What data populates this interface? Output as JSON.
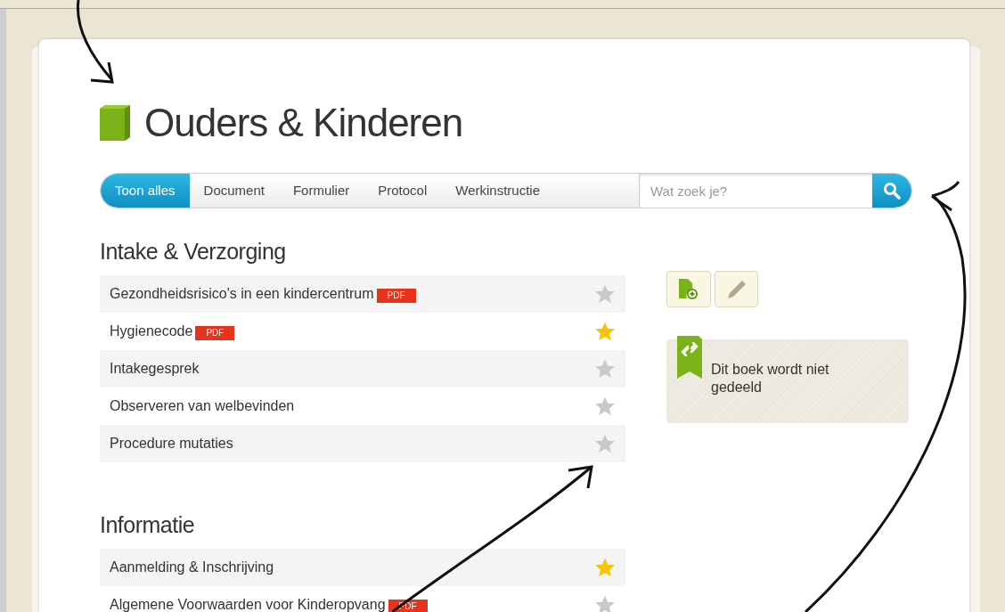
{
  "title": "Ouders & Kinderen",
  "filters": [
    {
      "label": "Toon alles",
      "selected": true
    },
    {
      "label": "Document",
      "selected": false
    },
    {
      "label": "Formulier",
      "selected": false
    },
    {
      "label": "Protocol",
      "selected": false
    },
    {
      "label": "Werkinstructie",
      "selected": false
    }
  ],
  "search": {
    "placeholder": "Wat zoek je?"
  },
  "sections": [
    {
      "heading": "Intake & Verzorging",
      "items": [
        {
          "name": "Gezondheidsrisico's in een kindercentrum",
          "badge": "PDF",
          "starred": false
        },
        {
          "name": "Hygienecode",
          "badge": "PDF",
          "starred": true
        },
        {
          "name": "Intakegesprek",
          "starred": false
        },
        {
          "name": "Observeren van welbevinden",
          "starred": false
        },
        {
          "name": "Procedure mutaties",
          "starred": false
        }
      ]
    },
    {
      "heading": "Informatie",
      "items": [
        {
          "name": "Aanmelding & Inschrijving",
          "starred": true
        },
        {
          "name": "Algemene Voorwaarden voor Kinderopvang",
          "badge": "PDF",
          "starred": false
        }
      ]
    }
  ],
  "share_notice": "Dit boek wordt niet gedeeld"
}
